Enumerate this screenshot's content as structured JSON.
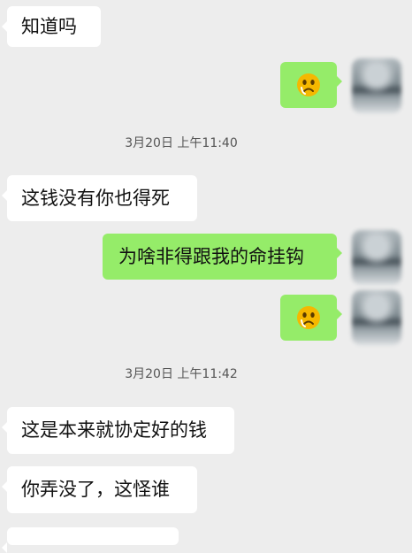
{
  "messages": {
    "in_1": "知道吗",
    "in_2": "这钱没有你也得死",
    "out_1": "为啥非得跟我的命挂钩",
    "in_3": "这是本来就协定好的钱",
    "in_4": "你弄没了，这怪谁"
  },
  "timestamps": {
    "first": "3月20日 上午11:40",
    "second": "3月20日 上午11:42"
  },
  "icons": {
    "sticker_1": "sad-face-emoji",
    "sticker_2": "sad-face-emoji",
    "avatar": "blurred-avatar"
  },
  "colors": {
    "background": "#ededed",
    "incoming_bubble": "#ffffff",
    "outgoing_bubble": "#95ec69",
    "text": "#111111",
    "timestamp": "#555555",
    "emoji": "#f5b800"
  }
}
